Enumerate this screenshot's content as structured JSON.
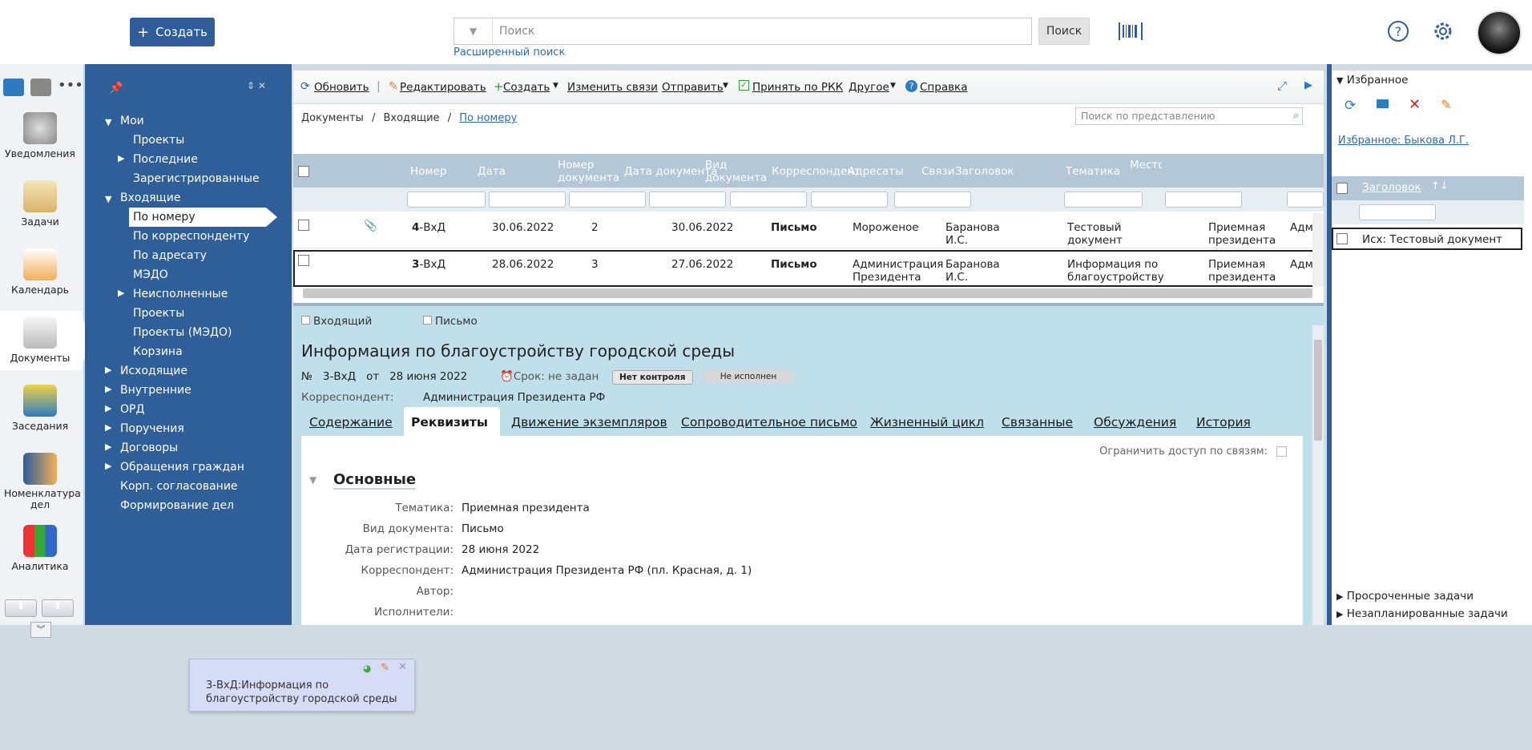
{
  "header": {
    "create_label": "Создать",
    "search_placeholder": "Поиск",
    "search_button": "Поиск",
    "advanced_search": "Расширенный поиск"
  },
  "left_apps": [
    {
      "label": "Уведомления",
      "icon": "megaphone-icon"
    },
    {
      "label": "Задачи",
      "icon": "tasks-icon"
    },
    {
      "label": "Календарь",
      "icon": "calendar-icon"
    },
    {
      "label": "Документы",
      "icon": "documents-icon"
    },
    {
      "label": "Заседания",
      "icon": "meeting-icon"
    },
    {
      "label": "Номенклатура дел",
      "icon": "nomenclature-icon"
    },
    {
      "label": "Аналитика",
      "icon": "analytics-icon"
    }
  ],
  "nav": {
    "items": [
      {
        "label": "Мои"
      },
      {
        "label": "Проекты"
      },
      {
        "label": "Последние"
      },
      {
        "label": "Зарегистрированные"
      },
      {
        "label": "Входящие"
      },
      {
        "label": "По номеру"
      },
      {
        "label": "По корреспонденту"
      },
      {
        "label": "По адресату"
      },
      {
        "label": "МЭДО"
      },
      {
        "label": "Неисполненные"
      },
      {
        "label": "Проекты"
      },
      {
        "label": "Проекты (МЭДО)"
      },
      {
        "label": "Корзина"
      },
      {
        "label": "Исходящие"
      },
      {
        "label": "Внутренние"
      },
      {
        "label": "ОРД"
      },
      {
        "label": "Поручения"
      },
      {
        "label": "Договоры"
      },
      {
        "label": "Обращения граждан"
      },
      {
        "label": "Корп. согласование"
      },
      {
        "label": "Формирование дел"
      }
    ]
  },
  "toolbar": {
    "refresh": "Обновить",
    "edit": "Редактировать",
    "create": "Создать",
    "change_links": "Изменить связи",
    "send": "Отправить",
    "accept_rkk": "Принять по РКК",
    "other": "Другое",
    "help": "Справка"
  },
  "breadcrumb": {
    "a": "Документы",
    "b": "Входящие",
    "c": "По номеру",
    "sep": "/"
  },
  "view_search_placeholder": "Поиск по представлению",
  "grid": {
    "columns": [
      "Номер",
      "Дата",
      "Номер документа",
      "Дата документа",
      "Вид документа",
      "Корреспондент",
      "Адресаты",
      "Связи",
      "Заголовок",
      "Тематика",
      "Место регист"
    ],
    "rows": [
      {
        "num_bold": "4",
        "num_rest": "-ВхД",
        "date": "30.06.2022",
        "docnum": "2",
        "docdate": "30.06.2022",
        "kind": "Письмо",
        "corr": "Мороженое",
        "addr": "Баранова И.С.",
        "title": "Тестовый документ",
        "topic": "Приемная президента",
        "place": "Адм"
      },
      {
        "num_bold": "3",
        "num_rest": "-ВхД",
        "date": "28.06.2022",
        "docnum": "3",
        "docdate": "27.06.2022",
        "kind": "Письмо",
        "corr": "Администрация Президента РФ",
        "addr": "Баранова И.С.",
        "title": "Информация по благоустройству городской среды",
        "topic": "Приемная президента",
        "place": "Адм"
      }
    ]
  },
  "detail": {
    "tag1": "Входящий",
    "tag2": "Письмо",
    "title": "Информация по благоустройству городской среды",
    "no_label": "№",
    "number": "3-ВхД",
    "from_label": "от",
    "date": "28 июня 2022",
    "deadline": "Срок: не задан",
    "no_control": "Нет контроля",
    "not_done": "Не исполнен",
    "corr_label": "Корреспондент:",
    "corr_value": "Администрация Президента РФ",
    "tabs": [
      "Содержание",
      "Реквизиты",
      "Движение экземпляров",
      "Сопроводительное письмо",
      "Жизненный цикл",
      "Связанные",
      "Обсуждения",
      "История"
    ],
    "restrict_label": "Ограничить доступ по связям:",
    "section": "Основные",
    "fields": [
      {
        "label": "Тематика:",
        "value": "Приемная президента"
      },
      {
        "label": "Вид документа:",
        "value": "Письмо"
      },
      {
        "label": "Дата регистрации:",
        "value": "28 июня 2022"
      },
      {
        "label": "Корреспондент:",
        "value": "Администрация Президента РФ (пл. Красная, д. 1)"
      },
      {
        "label": "Автор:",
        "value": ""
      },
      {
        "label": "Исполнители:",
        "value": ""
      }
    ]
  },
  "right": {
    "favorites": "Избранное",
    "fav_link": "Избранное: Быкова Л.Г.",
    "col_title": "Заголовок",
    "row": "Исх: Тестовый документ",
    "overdue": "Просроченные задачи",
    "unplanned": "Незапланированные задачи"
  },
  "popup": {
    "text": "3-ВхД:Информация по благоустройству городской среды"
  }
}
